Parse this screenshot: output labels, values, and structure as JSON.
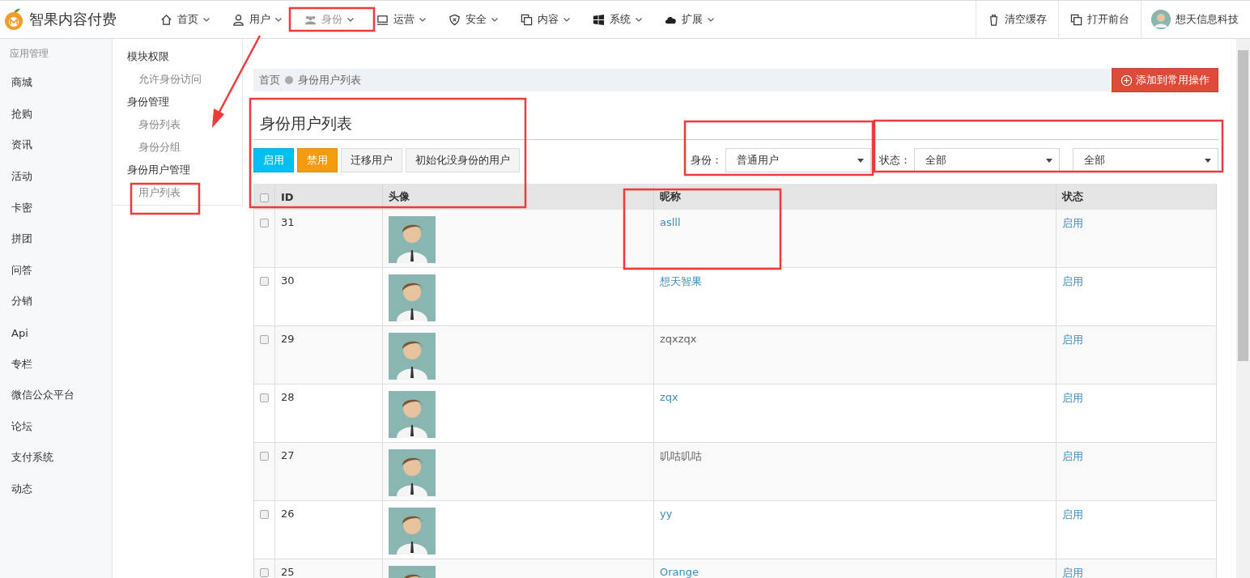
{
  "brand": {
    "name": "智果内容付费"
  },
  "nav": [
    {
      "label": "首页",
      "selected": false
    },
    {
      "label": "用户",
      "selected": false
    },
    {
      "label": "身份",
      "selected": true
    },
    {
      "label": "运营",
      "selected": false
    },
    {
      "label": "安全",
      "selected": false
    },
    {
      "label": "内容",
      "selected": false
    },
    {
      "label": "系统",
      "selected": false
    },
    {
      "label": "扩展",
      "selected": false
    }
  ],
  "header_actions": [
    {
      "label": "清空缓存"
    },
    {
      "label": "打开前台"
    }
  ],
  "account": {
    "name": "想天信息科技"
  },
  "sidebar": {
    "heading": "应用管理",
    "items": [
      "商城",
      "抢购",
      "资讯",
      "活动",
      "卡密",
      "拼团",
      "问答",
      "分销",
      "Api",
      "专栏",
      "微信公众平台",
      "论坛",
      "支付系统",
      "动态"
    ]
  },
  "submenu": {
    "groups": [
      {
        "title": "模块权限",
        "items": [
          "允许身份访问"
        ]
      },
      {
        "title": "身份管理",
        "items": [
          "身份列表",
          "身份分组"
        ]
      },
      {
        "title": "身份用户管理",
        "items": [
          "用户列表"
        ]
      }
    ]
  },
  "breadcrumb": [
    "首页",
    "身份用户列表"
  ],
  "add_button": "添加到常用操作",
  "page_title": "身份用户列表",
  "actions": [
    {
      "label": "启用",
      "kind": "primary"
    },
    {
      "label": "禁用",
      "kind": "warning"
    },
    {
      "label": "迁移用户",
      "kind": "default"
    },
    {
      "label": "初始化没身份的用户",
      "kind": "default"
    }
  ],
  "filters": [
    {
      "label": "身份：",
      "value": "普通用户"
    },
    {
      "label": "状态：",
      "value": "全部"
    },
    {
      "value": "全部"
    }
  ],
  "table": {
    "columns": [
      "ID",
      "头像",
      "昵称",
      "状态"
    ],
    "select_all_checked": false,
    "rows": [
      {
        "id": "31",
        "nickname": "aslll",
        "linked": true,
        "status": "启用",
        "checked": false
      },
      {
        "id": "30",
        "nickname": "想天智果",
        "linked": true,
        "status": "启用",
        "checked": false
      },
      {
        "id": "29",
        "nickname": "zqxzqx",
        "linked": false,
        "status": "启用",
        "checked": false
      },
      {
        "id": "28",
        "nickname": "zqx",
        "linked": true,
        "status": "启用",
        "checked": false
      },
      {
        "id": "27",
        "nickname": "叽咕叽咕",
        "linked": false,
        "status": "启用",
        "checked": false
      },
      {
        "id": "26",
        "nickname": "yy",
        "linked": true,
        "status": "启用",
        "checked": false
      },
      {
        "id": "25",
        "nickname": "Orange",
        "linked": true,
        "status": "启用",
        "checked": false
      }
    ]
  }
}
